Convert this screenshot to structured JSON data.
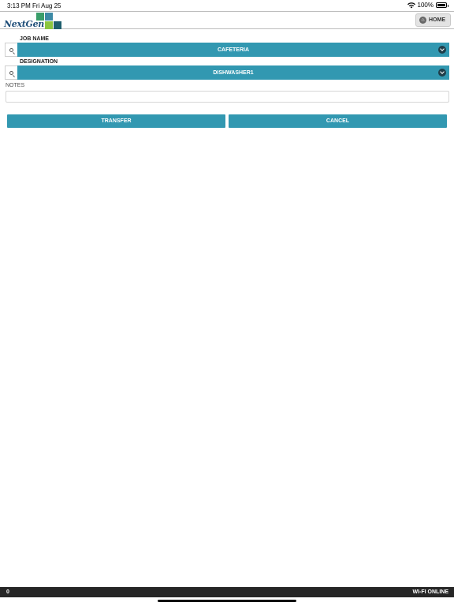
{
  "status_bar": {
    "time": "3:13 PM",
    "date": "Fri Aug 25",
    "battery": "100%",
    "icons": [
      "wifi-icon",
      "battery-icon"
    ]
  },
  "header": {
    "logo_text": "NextGen",
    "home_label": "HOME",
    "home_icon": "home-icon",
    "logo_colors": [
      "#3a9e6a",
      "#3d8aa6",
      "#8cc63f",
      "#1f5f6e"
    ]
  },
  "form": {
    "job_name": {
      "label": "JOB NAME",
      "value": "CAFETERIA"
    },
    "designation": {
      "label": "DESIGNATION",
      "value": "DISHWASHER1"
    },
    "notes": {
      "label": "NOTES",
      "value": "",
      "placeholder": ""
    }
  },
  "actions": {
    "transfer_label": "TRANSFER",
    "cancel_label": "CANCEL"
  },
  "footer": {
    "left_text": "0",
    "right_text": "WI-FI ONLINE"
  },
  "colors": {
    "accent": "#3298b1",
    "footer": "#262626",
    "chevron": "#1f3e4a"
  }
}
